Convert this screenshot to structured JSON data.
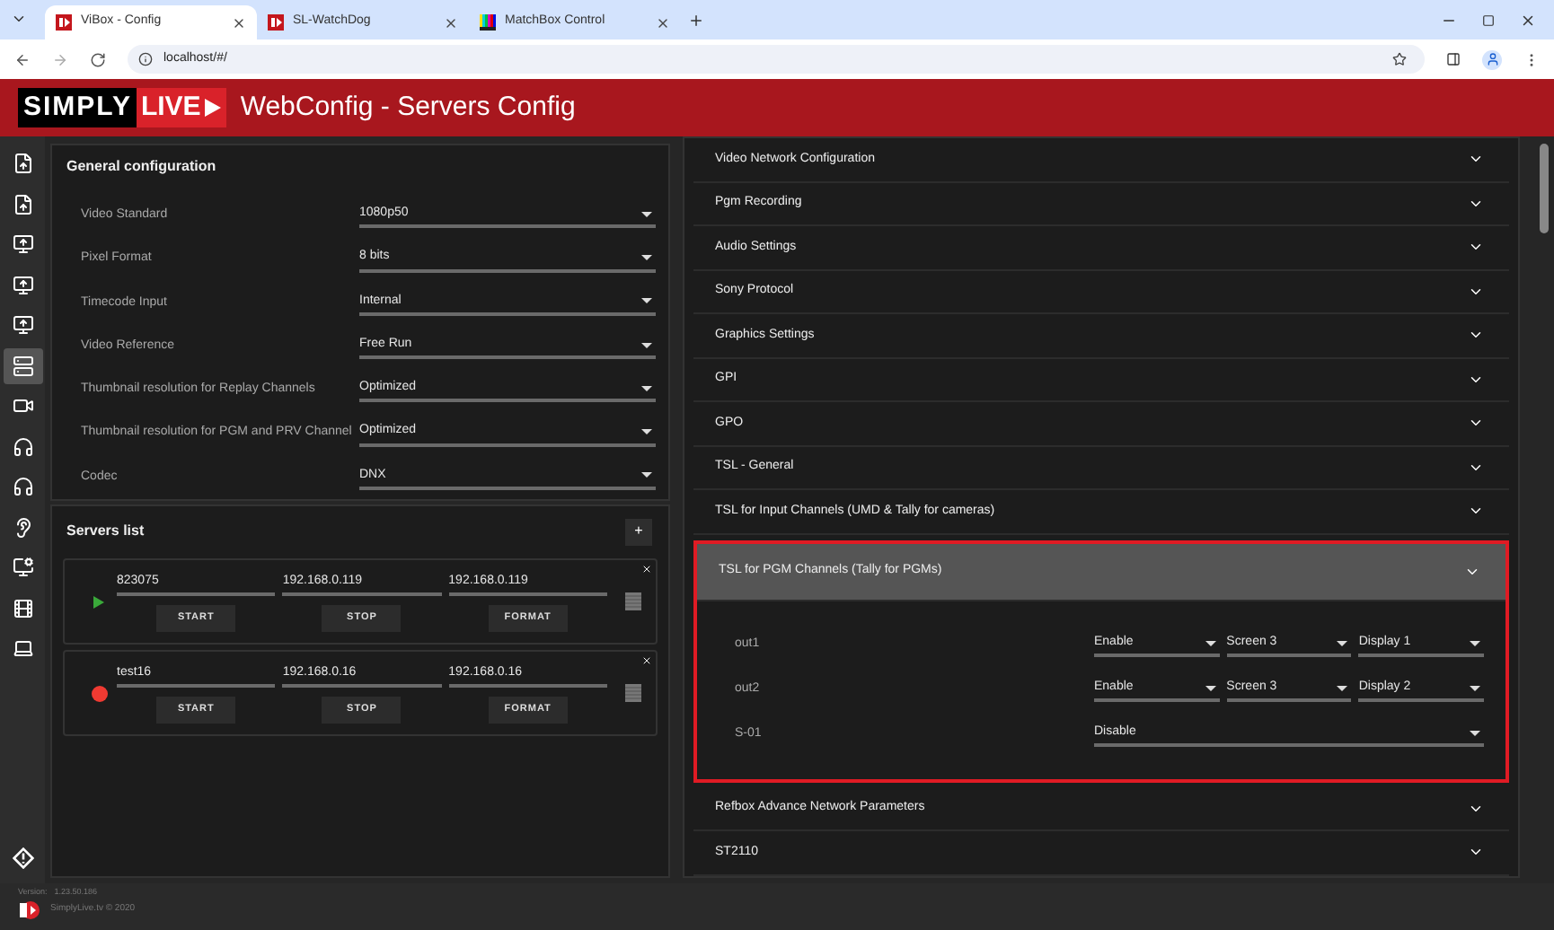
{
  "browser": {
    "tabs": [
      {
        "title": "ViBox - Config",
        "selected": true,
        "kind": "sl"
      },
      {
        "title": "SL-WatchDog",
        "selected": false,
        "kind": "sl"
      },
      {
        "title": "MatchBox Control",
        "selected": false,
        "kind": "bars"
      }
    ],
    "address": "localhost/#/"
  },
  "header": {
    "logo": {
      "simply": "SIMPLY",
      "live": "LIVE"
    },
    "title": "WebConfig - Servers Config"
  },
  "sidebar": {
    "items": [
      {
        "kind": "file",
        "selected": false
      },
      {
        "kind": "file",
        "selected": false
      },
      {
        "kind": "server",
        "selected": false
      },
      {
        "kind": "server",
        "selected": false
      },
      {
        "kind": "server",
        "selected": false
      },
      {
        "kind": "list",
        "selected": true
      },
      {
        "kind": "camera",
        "selected": false
      },
      {
        "kind": "headset",
        "selected": false
      },
      {
        "kind": "headset",
        "selected": false
      },
      {
        "kind": "hearing",
        "selected": false
      },
      {
        "kind": "display",
        "selected": false
      },
      {
        "kind": "recorder",
        "selected": false
      },
      {
        "kind": "laptop",
        "selected": false
      }
    ]
  },
  "general": {
    "title": "General configuration",
    "fields": [
      {
        "label": "Video Standard",
        "value": "1080p50"
      },
      {
        "label": "Pixel Format",
        "value": "8 bits"
      },
      {
        "label": "Timecode Input",
        "value": "Internal"
      },
      {
        "label": "Video Reference",
        "value": "Free Run"
      },
      {
        "label": "Thumbnail resolution for Replay Channels",
        "value": "Optimized"
      },
      {
        "label": "Thumbnail resolution for PGM and PRV Channel",
        "value": "Optimized"
      },
      {
        "label": "Codec",
        "value": "DNX"
      }
    ]
  },
  "servers": {
    "title": "Servers list",
    "add": "+",
    "items": [
      {
        "kind": "running",
        "name": "823075",
        "address_1": "192.168.0.119",
        "address_2": "192.168.0.119",
        "buttons": [
          "START",
          "STOP",
          "FORMAT"
        ]
      },
      {
        "kind": "recording",
        "name": "test16",
        "address_1": "192.168.0.16",
        "address_2": "192.168.0.16",
        "buttons": [
          "START",
          "STOP",
          "FORMAT"
        ]
      }
    ]
  },
  "settings": {
    "sections": [
      {
        "title": "Video Network Configuration",
        "expanded": false
      },
      {
        "title": "Pgm Recording",
        "expanded": false
      },
      {
        "title": "Audio Settings",
        "expanded": false
      },
      {
        "title": "Sony Protocol",
        "expanded": false
      },
      {
        "title": "Graphics Settings",
        "expanded": false
      },
      {
        "title": "GPI",
        "expanded": false
      },
      {
        "title": "GPO",
        "expanded": false
      },
      {
        "title": "TSL - General",
        "expanded": false
      },
      {
        "title": "TSL for Input Channels (UMD & Tally for cameras)",
        "expanded": false
      },
      {
        "title": "TSL for PGM Channels (Tally for PGMs)",
        "expanded": true,
        "highlighted": true,
        "rows": [
          {
            "label": "out1",
            "selects": [
              "Enable",
              "Screen 3",
              "Display 1"
            ]
          },
          {
            "label": "out2",
            "selects": [
              "Enable",
              "Screen 3",
              "Display 2"
            ]
          },
          {
            "label": "S-01",
            "selects": [
              "Disable"
            ]
          }
        ]
      },
      {
        "title": "Refbox Advance Network Parameters",
        "expanded": false
      },
      {
        "title": "ST2110",
        "expanded": false
      }
    ]
  },
  "footer": {
    "version_label": "Version:",
    "version": "1.23.50.186",
    "copyright": "SimplyLive.tv © 2020"
  }
}
